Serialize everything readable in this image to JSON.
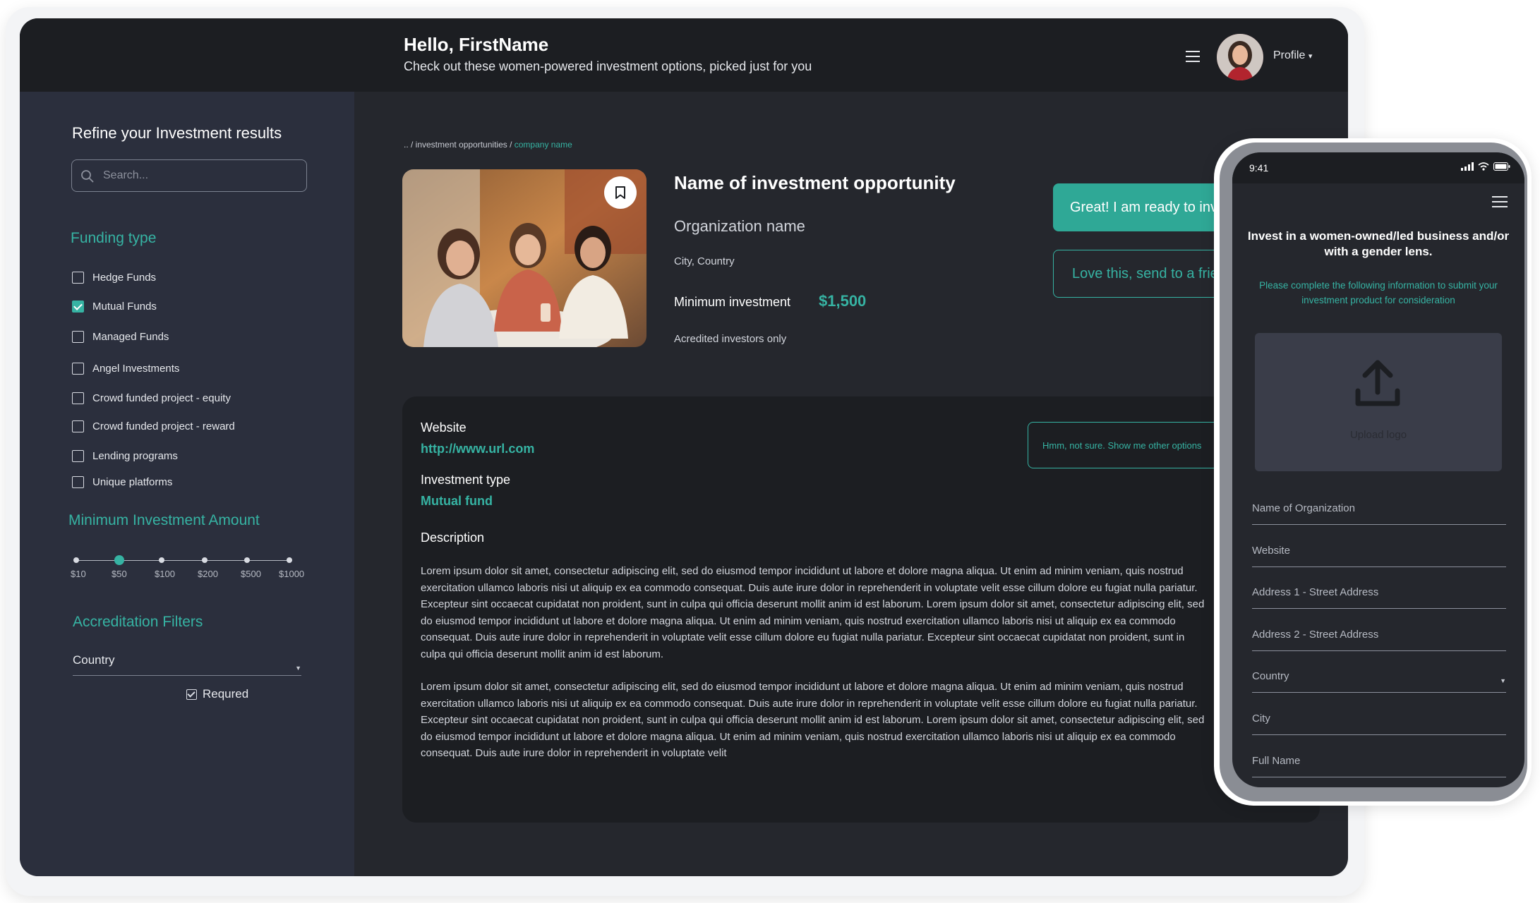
{
  "header": {
    "greeting": "Hello, FirstName",
    "subtitle": "Check out these women-powered investment options, picked just for you",
    "profile_label": "Profile",
    "profile_caret": "▾"
  },
  "sidebar": {
    "title": "Refine your Investment results",
    "search_placeholder": "Search...",
    "funding_type_title": "Funding type",
    "funding_types": [
      {
        "label": "Hedge Funds",
        "checked": false
      },
      {
        "label": "Mutual Funds",
        "checked": true
      },
      {
        "label": "Managed Funds",
        "checked": false
      },
      {
        "label": "Angel Investments",
        "checked": false
      },
      {
        "label": "Crowd funded project - equity",
        "checked": false
      },
      {
        "label": "Crowd funded project - reward",
        "checked": false
      },
      {
        "label": "Lending programs",
        "checked": false
      },
      {
        "label": "Unique platforms",
        "checked": false
      }
    ],
    "min_investment_title": "Minimum Investment Amount",
    "slider_labels": [
      "$10",
      "$50",
      "$100",
      "$200",
      "$500",
      "$1000"
    ],
    "slider_selected_index": 1,
    "accreditation_title": "Accreditation Filters",
    "country_label": "Country",
    "required_label": "Requred"
  },
  "main": {
    "breadcrumb_prefix": ".. / investment opportunities / ",
    "breadcrumb_current": "company name",
    "opportunity_title": "Name of investment opportunity",
    "organization_name": "Organization name",
    "city_country": "City, Country",
    "min_investment_label": "Minimum investment",
    "min_investment_value": "$1,500",
    "accredited_note": "Acredited investors only",
    "primary_button": "Great! I am ready to invest",
    "share_button": "Love this, send to a friend",
    "other_options_button": "Hmm, not sure. Show me other options",
    "website_label": "Website",
    "website_value": "http://www.url.com",
    "investment_type_label": "Investment type",
    "investment_type_value": "Mutual fund",
    "description_label": "Description",
    "description_paragraphs": [
      "Lorem ipsum dolor sit amet, consectetur adipiscing elit, sed do eiusmod tempor incididunt ut labore et dolore magna aliqua. Ut enim ad minim veniam, quis nostrud exercitation ullamco laboris nisi ut aliquip ex ea commodo consequat. Duis aute irure dolor in reprehenderit in voluptate velit esse cillum dolore eu fugiat nulla pariatur. Excepteur sint occaecat cupidatat non proident, sunt in culpa qui officia deserunt mollit anim id est laborum. Lorem ipsum dolor sit amet, consectetur adipiscing elit, sed do eiusmod tempor incididunt ut labore et dolore magna aliqua. Ut enim ad minim veniam, quis nostrud exercitation ullamco laboris nisi ut aliquip ex ea commodo consequat. Duis aute irure dolor in reprehenderit in voluptate velit esse cillum dolore eu fugiat nulla pariatur. Excepteur sint occaecat cupidatat non proident, sunt in culpa qui officia deserunt mollit anim id est laborum.",
      "Lorem ipsum dolor sit amet, consectetur adipiscing elit, sed do eiusmod tempor incididunt ut labore et dolore magna aliqua. Ut enim ad minim veniam, quis nostrud exercitation ullamco laboris nisi ut aliquip ex ea commodo consequat. Duis aute irure dolor in reprehenderit in voluptate velit esse cillum dolore eu fugiat nulla pariatur. Excepteur sint occaecat cupidatat non proident, sunt in culpa qui officia deserunt mollit anim id est laborum. Lorem ipsum dolor sit amet, consectetur adipiscing elit, sed do eiusmod tempor incididunt ut labore et dolore magna aliqua. Ut enim ad minim veniam, quis nostrud exercitation ullamco laboris nisi ut aliquip ex ea commodo consequat. Duis aute irure dolor in reprehenderit in voluptate velit"
    ]
  },
  "phone": {
    "time": "9:41",
    "headline": "Invest in a women-owned/led business and/or with a gender lens.",
    "subtext": "Please complete the following information to submit your investment product for consideration",
    "upload_label": "Upload logo",
    "fields": [
      "Name of Organization",
      "Website",
      "Address 1 - Street Address",
      "Address 2 - Street Address",
      "Country",
      "City",
      "Full Name"
    ]
  },
  "colors": {
    "accent": "#36b3a3",
    "header_bg": "#1c1e22",
    "sidebar_bg": "#2b2f3d",
    "main_bg": "#25272d"
  },
  "icons": [
    "menu-icon",
    "search-icon",
    "bookmark-icon",
    "upload-icon",
    "signal-icon",
    "wifi-icon",
    "battery-icon",
    "chevron-down-icon"
  ]
}
